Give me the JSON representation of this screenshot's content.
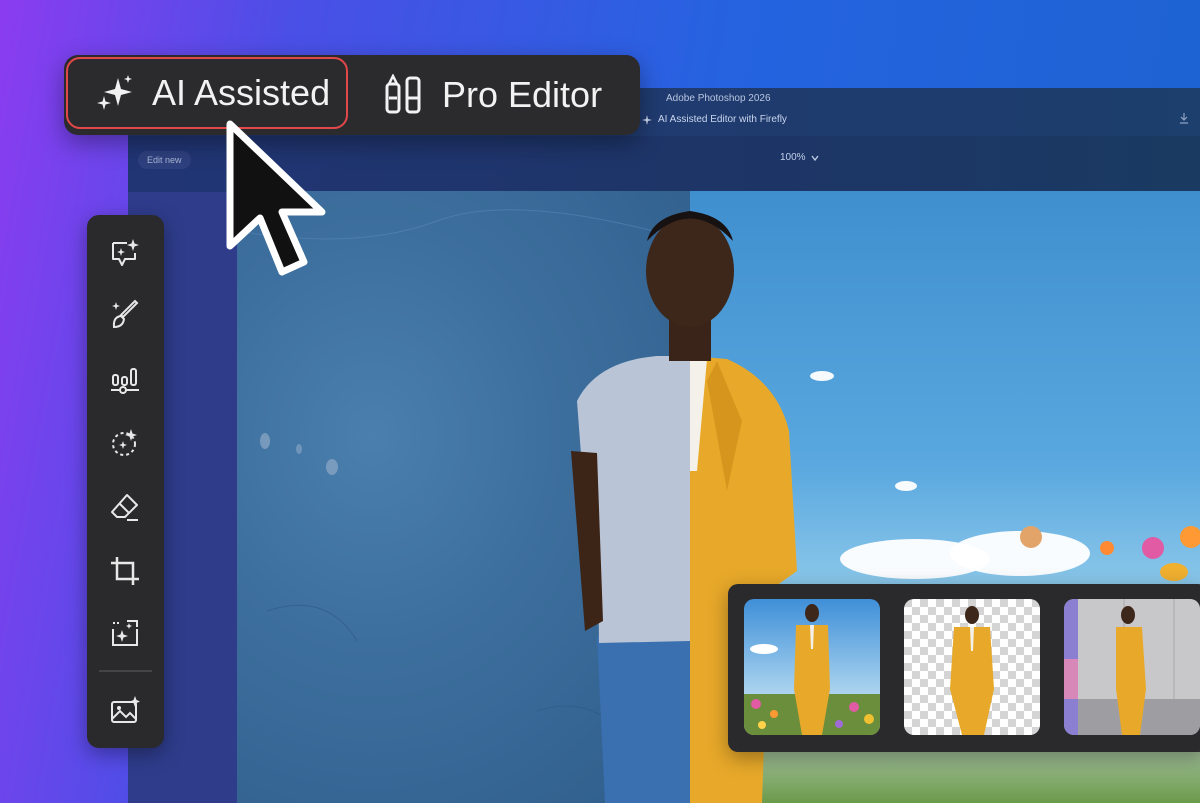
{
  "window": {
    "app_title": "Adobe Photoshop 2026",
    "doc_tab_label": "AI Assisted Editor with Firefly",
    "edit_new_label": "Edit new",
    "zoom_label": "100%"
  },
  "mode_switcher": {
    "options": [
      {
        "label": "AI Assisted",
        "icon": "sparkle-icon",
        "active": true
      },
      {
        "label": "Pro Editor",
        "icon": "brush-pencil-icon",
        "active": false
      }
    ],
    "active_border_color": "#e0484a"
  },
  "toolbar": {
    "tools": [
      {
        "name": "generative-chat",
        "icon": "chat-sparkle-icon"
      },
      {
        "name": "brush",
        "icon": "brush-sparkle-icon"
      },
      {
        "name": "adjustments",
        "icon": "sliders-icon"
      },
      {
        "name": "select-subject",
        "icon": "lasso-sparkle-icon"
      },
      {
        "name": "eraser",
        "icon": "eraser-icon"
      },
      {
        "name": "crop",
        "icon": "crop-icon"
      },
      {
        "name": "generative-expand",
        "icon": "expand-sparkle-icon"
      },
      {
        "name": "image-generate",
        "icon": "image-sparkle-icon"
      }
    ]
  },
  "variations": {
    "thumbnails": [
      {
        "name": "flower-field-variation"
      },
      {
        "name": "transparent-background-variation"
      },
      {
        "name": "concrete-room-variation"
      }
    ]
  },
  "colors": {
    "background_start": "#8b3cf0",
    "background_end": "#1c63d0",
    "panel": "#2a2a2c",
    "suit": "#e8a92a"
  }
}
